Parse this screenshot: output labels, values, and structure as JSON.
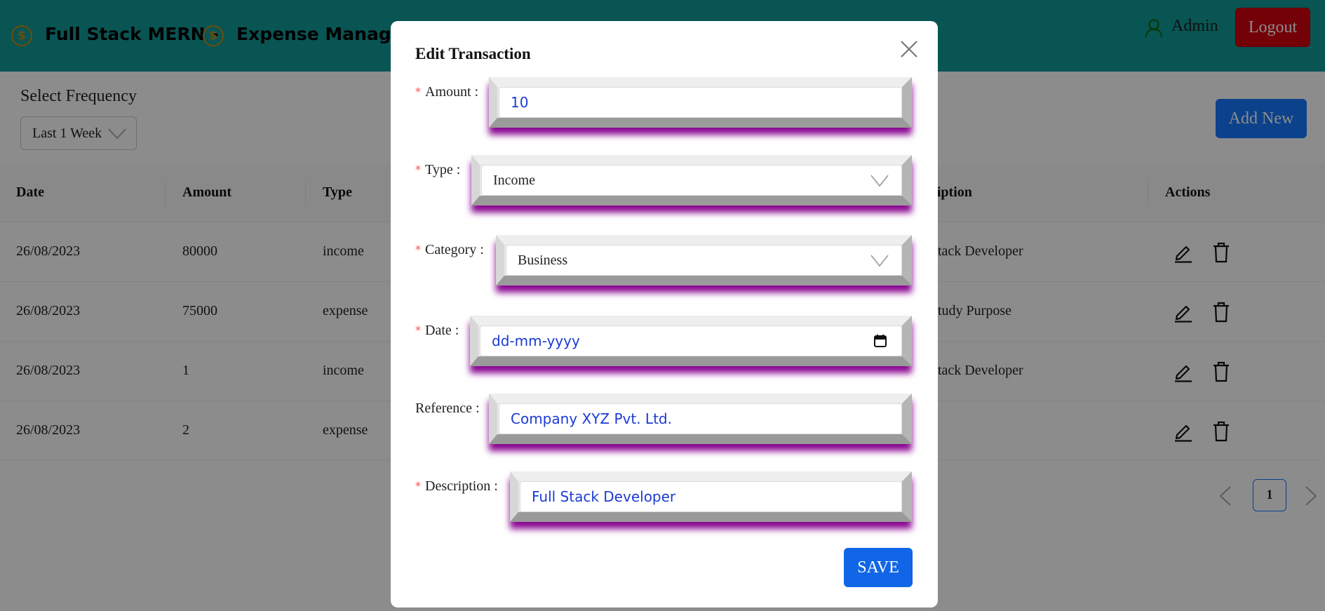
{
  "header": {
    "brand_part1": "Full Stack MERN -",
    "brand_part2": "Expense Manager",
    "coin_symbol": "$",
    "user_name": "Admin",
    "logout_label": "Logout"
  },
  "filters": {
    "frequency_label": "Select Frequency",
    "frequency_value": "Last 1 Week"
  },
  "add_new_label": "Add New",
  "table": {
    "columns": [
      "Date",
      "Amount",
      "Type",
      "ription",
      "Actions"
    ],
    "rows": [
      {
        "date": "26/08/2023",
        "amount": "80000",
        "type": "income",
        "description": "tack Developer"
      },
      {
        "date": "26/08/2023",
        "amount": "75000",
        "type": "expense",
        "description": "tudy Purpose"
      },
      {
        "date": "26/08/2023",
        "amount": "1",
        "type": "income",
        "description": "tack Developer"
      },
      {
        "date": "26/08/2023",
        "amount": "2",
        "type": "expense",
        "description": ""
      }
    ]
  },
  "pagination": {
    "current_page": "1"
  },
  "modal": {
    "title": "Edit Transaction",
    "required_mark": "*",
    "fields": {
      "amount": {
        "label": "Amount :",
        "value": "10"
      },
      "type": {
        "label": "Type :",
        "value": "Income"
      },
      "category": {
        "label": "Category :",
        "value": "Business"
      },
      "date": {
        "label": "Date :",
        "value": "dd-mm-yyyy"
      },
      "reference": {
        "label": "Reference :",
        "value": "Company XYZ Pvt. Ltd."
      },
      "description": {
        "label": "Description :",
        "value": "Full Stack Developer"
      }
    },
    "save_label": "SAVE"
  },
  "colors": {
    "header_bg": "#119c99",
    "primary": "#1677ff",
    "danger": "#d40010",
    "coin": "#c98a12",
    "input_shadow": "#8a0892"
  }
}
